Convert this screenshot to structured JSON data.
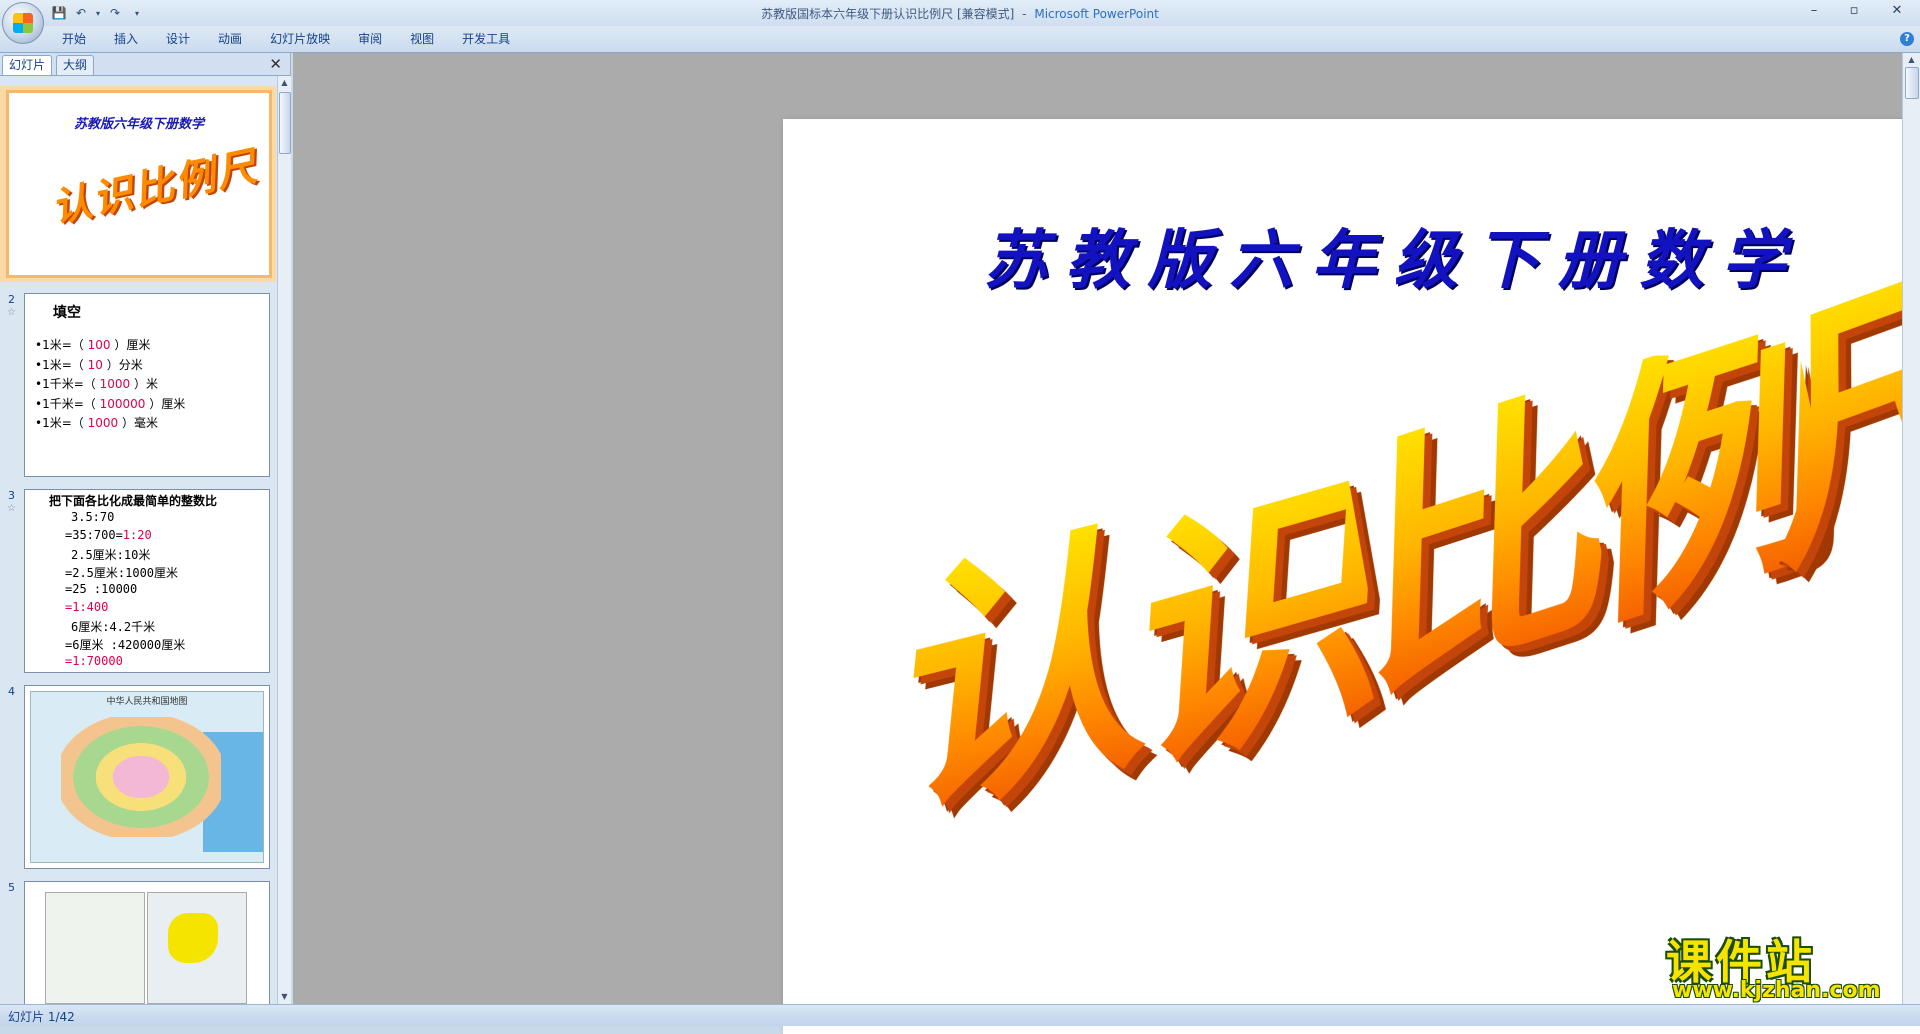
{
  "window": {
    "title": "苏教版国标本六年级下册认识比例尺 [兼容模式]",
    "separator": "-",
    "app_name": "Microsoft PowerPoint",
    "controls": {
      "minimize": "–",
      "maximize": "▫",
      "close": "✕"
    }
  },
  "qat": {
    "save": "💾",
    "undo": "↶",
    "undo_arrow": "▾",
    "redo": "↷",
    "customize": "▾"
  },
  "ribbon": {
    "tabs": [
      "开始",
      "插入",
      "设计",
      "动画",
      "幻灯片放映",
      "审阅",
      "视图",
      "开发工具"
    ],
    "help": "?"
  },
  "panel": {
    "tab_slides": "幻灯片",
    "tab_outline": "大纲",
    "close": "✕",
    "scroll_up": "▲",
    "scroll_down": "▼",
    "slides": [
      {
        "number": "1",
        "subtitle": "苏教版六年级下册数学",
        "title": "认识比例尺"
      },
      {
        "number": "2",
        "title": "填空",
        "lines": [
          {
            "pre": "•1米=（ ",
            "ans": "100",
            "post": "   ）厘米"
          },
          {
            "pre": "•1米=（ ",
            "ans": "10",
            "post": "   ）分米"
          },
          {
            "pre": "•1千米=（ ",
            "ans": "1000",
            "post": "  ）米"
          },
          {
            "pre": "•1千米=（ ",
            "ans": "100000",
            "post": "   ）厘米"
          },
          {
            "pre": "•1米=（ ",
            "ans": "1000",
            "post": "  ）毫米"
          }
        ]
      },
      {
        "number": "3",
        "title": "把下面各比化成最简单的整数比",
        "lines": [
          {
            "text": "3.5:70",
            "red": "",
            "indent": 1
          },
          {
            "text": "=35:700=",
            "red": "1:20",
            "indent": 0
          },
          {
            "text": "2.5厘米:10米",
            "red": "",
            "indent": 1
          },
          {
            "text": "=2.5厘米:1000厘米",
            "red": "",
            "indent": 0
          },
          {
            "text": "=25 :10000",
            "red": "",
            "indent": 0
          },
          {
            "text": "",
            "red": "=1:400",
            "indent": 0
          },
          {
            "text": "6厘米:4.2千米",
            "red": "",
            "indent": 1
          },
          {
            "text": "=6厘米 :420000厘米",
            "red": "",
            "indent": 0
          },
          {
            "text": "",
            "red": "=1:70000",
            "indent": 0
          }
        ]
      },
      {
        "number": "4",
        "header": "中华人民共和国地图"
      },
      {
        "number": "5"
      }
    ],
    "star": "☆"
  },
  "slide": {
    "subtitle": "苏教版六年级下册数学",
    "title_chars": [
      "认",
      "识",
      "比",
      "例",
      "尺"
    ]
  },
  "status": {
    "text": "幻灯片 1/42"
  },
  "watermark": {
    "top": "课件站",
    "bottom": "www.kjzhan.com"
  },
  "colors": {
    "answer_red": "#e0004d",
    "subtitle_blue": "#1212c0",
    "title_orange": "#ff8c00"
  }
}
